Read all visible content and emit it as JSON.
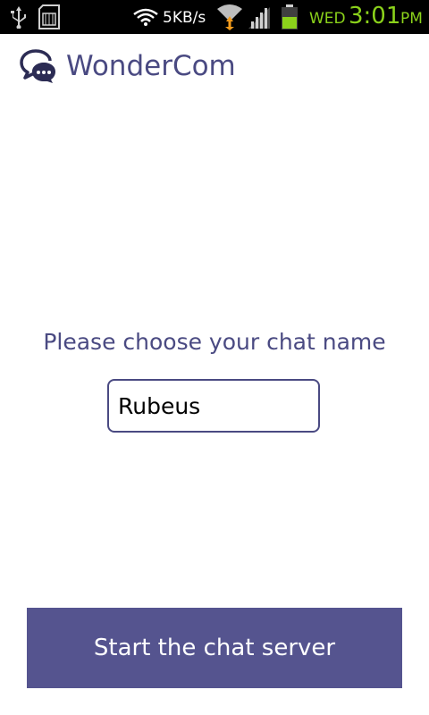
{
  "status_bar": {
    "net_speed": "5KB/s",
    "day": "WED",
    "time": "3:01",
    "ampm": "PM",
    "icons": [
      "usb-icon",
      "sd-card-icon",
      "wifi-speed-icon",
      "wifi-icon",
      "signal-icon",
      "battery-icon"
    ],
    "accent_color": "#8bd21b"
  },
  "app_bar": {
    "title": "WonderCom",
    "logo_icon": "chat-bubbles-icon"
  },
  "main": {
    "prompt": "Please choose your chat name",
    "name_input": {
      "value": "Rubeus",
      "placeholder": ""
    },
    "start_button_label": "Start the chat server"
  },
  "colors": {
    "brand": "#4a4a82",
    "button": "#55548f",
    "status_bar_bg": "#000000"
  }
}
